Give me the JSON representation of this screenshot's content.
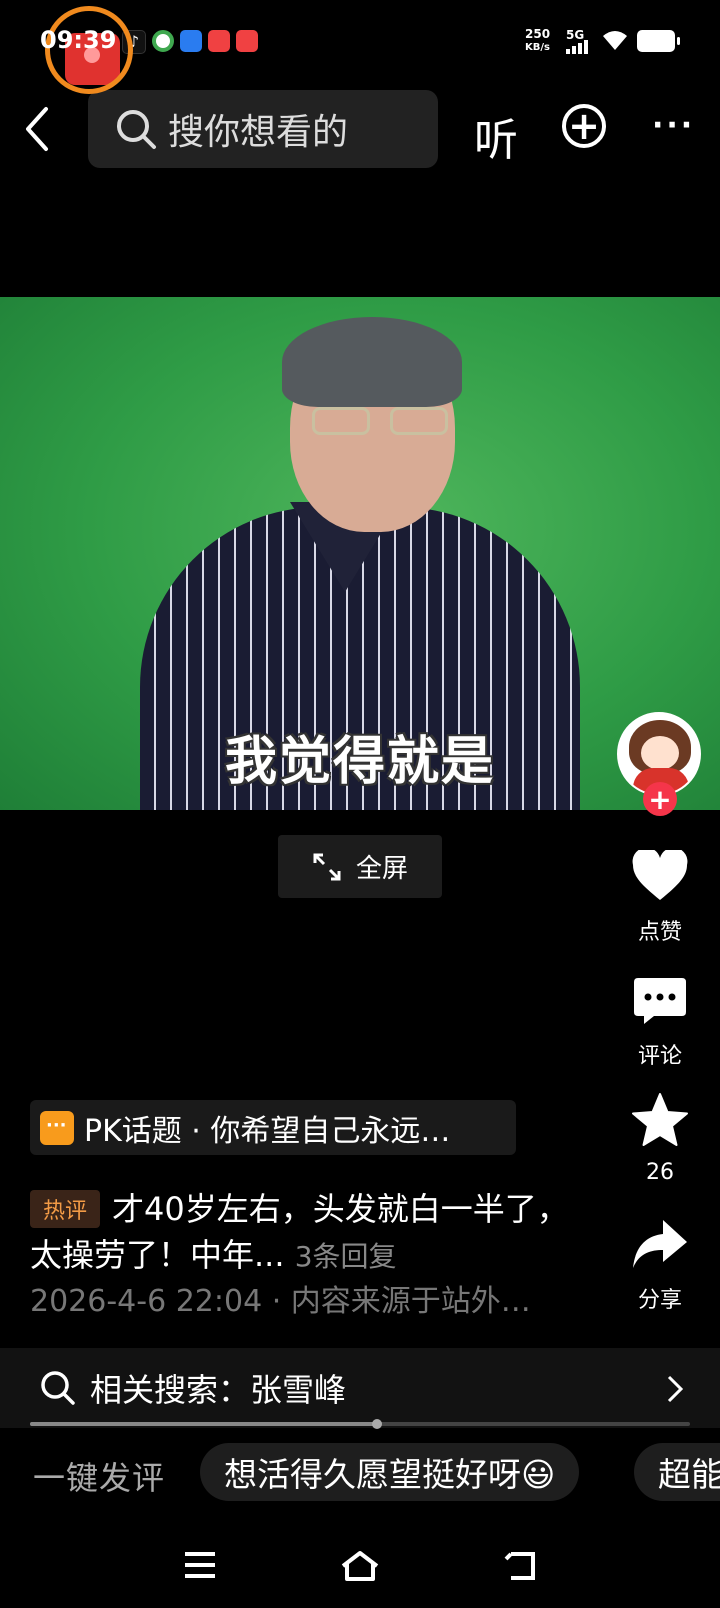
{
  "status_bar": {
    "time": "09:39",
    "net_speed_value": "250",
    "net_speed_unit": "KB/s",
    "network": "5G",
    "notification_icons": [
      "tiktok-icon",
      "recycle-app-icon",
      "blue-app-icon",
      "toutiao-icon",
      "toutiao-icon"
    ]
  },
  "header": {
    "search_placeholder": "搜你想看的",
    "listen_label": "听"
  },
  "video": {
    "subtitle": "我觉得就是",
    "fullscreen_label": "全屏"
  },
  "actions": {
    "like_label": "点赞",
    "comment_label": "评论",
    "favorite_count": "26",
    "share_label": "分享"
  },
  "post": {
    "topic": "PK话题 · 你希望自己永远…",
    "hot_tag": "热评",
    "comment": "才40岁左右，头发就白一半了，太操劳了！中年...",
    "reply_count": "3条回复",
    "meta": "2026-4-6 22:04 · 内容来源于站外…"
  },
  "related_search": {
    "label": "相关搜索：张雪峰",
    "progress": 0.525
  },
  "quick_comment": {
    "label": "一键发评",
    "chips": [
      "想活得久愿望挺好呀😃",
      "超能"
    ]
  },
  "colors": {
    "record_ring": "#f08a1e",
    "follow_button": "#f5354a",
    "hot_tag_text": "#f39b46",
    "topic_icon": "#f89b1c"
  }
}
